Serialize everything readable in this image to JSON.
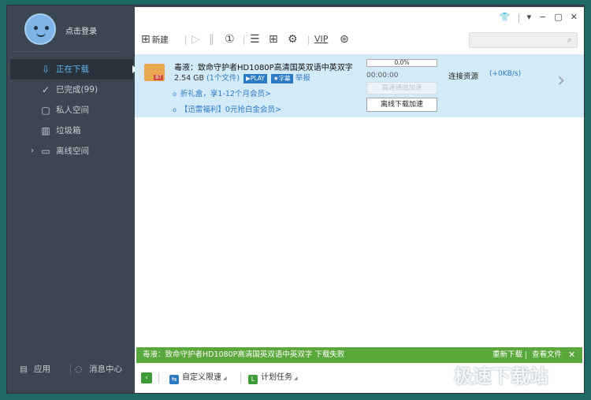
{
  "sidebar": {
    "login": "点击登录",
    "items": [
      {
        "label": "正在下载",
        "icon": "download-icon"
      },
      {
        "label": "已完成(99)",
        "icon": "check-circle-icon"
      },
      {
        "label": "私人空间",
        "icon": "lock-icon"
      },
      {
        "label": "垃圾箱",
        "icon": "trash-icon"
      },
      {
        "label": "离线空间",
        "icon": "cloud-monitor-icon"
      }
    ],
    "bottom": {
      "app": "应用",
      "message": "消息中心"
    }
  },
  "toolbar": {
    "new_label": "新建",
    "vip": "VIP",
    "search_placeholder": ""
  },
  "task": {
    "name": "毒液：致命守护者HD1080P高清国英双语中英双字",
    "size": "2.54 GB",
    "files": "(1个文件)",
    "play_badge": "PLAY",
    "subtitle_badge": "字幕",
    "report": "举报",
    "link1": "折礼盒，享1-12个月会员>",
    "link2": "【迅雷福利】0元抢白金会员>",
    "progress_text": "0.0%",
    "progress": 0.0,
    "time": "00:00:00",
    "high_speed_btn": "高速通道加速",
    "offline_btn": "离线下载加速",
    "connection": "连接资源",
    "speed": "(+0KB/s)",
    "file_badge": "BT"
  },
  "notice": {
    "text": "毒液：致命守护者HD1080P高清国英双语中英双字 下载失败",
    "redownload": "重新下载",
    "view_file": "查看文件",
    "close": "✕"
  },
  "bottombar": {
    "speed_limit": "自定义限速",
    "schedule": "计划任务"
  },
  "watermark": "极速下载站",
  "colors": {
    "accent_blue": "#2a79c2",
    "notice_green": "#5aa83b",
    "sidebar": "#3b4650",
    "row_bg": "#d3eaf9"
  }
}
